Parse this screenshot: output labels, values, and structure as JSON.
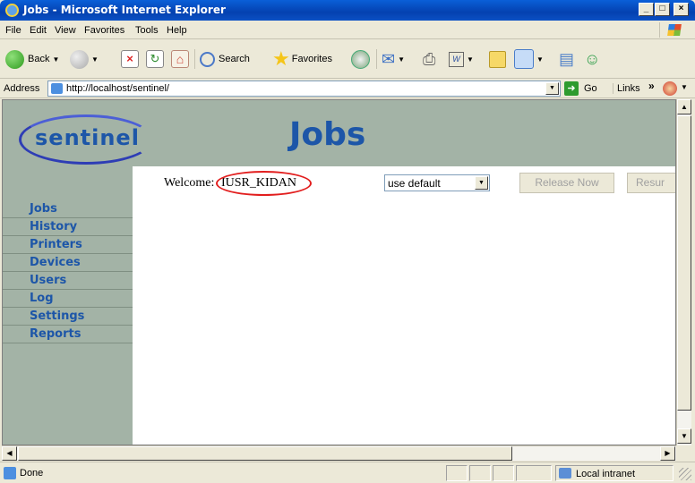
{
  "window": {
    "title": "Jobs - Microsoft Internet Explorer"
  },
  "menu": [
    "File",
    "Edit",
    "View",
    "Favorites",
    "Tools",
    "Help"
  ],
  "toolbar": {
    "back_label": "Back",
    "search_label": "Search",
    "favorites_label": "Favorites"
  },
  "address": {
    "label": "Address",
    "url": "http://localhost/sentinel/",
    "go_label": "Go",
    "links_label": "Links"
  },
  "page": {
    "logo_text": "sentinel",
    "heading": "Jobs",
    "welcome_label": "Welcome:",
    "username": "IUSR_KIDAN",
    "printer_select": {
      "selected": "use default"
    },
    "release_button": "Release Now",
    "resume_button": "Resur"
  },
  "nav": {
    "items": [
      {
        "label": "Jobs"
      },
      {
        "label": "History"
      },
      {
        "label": "Printers"
      },
      {
        "label": "Devices"
      },
      {
        "label": "Users"
      },
      {
        "label": "Log"
      },
      {
        "label": "Settings"
      },
      {
        "label": "Reports"
      }
    ]
  },
  "status": {
    "text": "Done",
    "zone": "Local intranet"
  }
}
